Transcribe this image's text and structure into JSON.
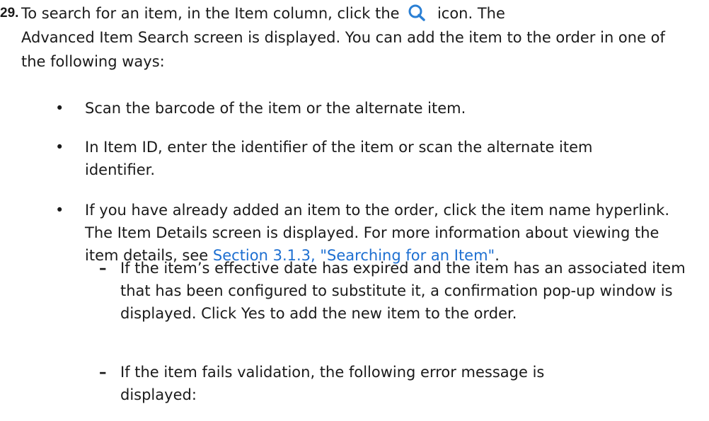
{
  "step": {
    "number": "29.",
    "line1_before_icon": "To search for an item, in the Item column, click the",
    "search_icon": "search-icon",
    "line1_after_icon": "icon. The",
    "continuation": "Advanced Item Search screen is displayed. You can add the item to the order in one of the following ways:"
  },
  "bullets": [
    {
      "text": "Scan the barcode of the item or the alternate item."
    },
    {
      "text": "In Item ID, enter the identifier of the item or scan the alternate item identifier."
    },
    {
      "text": "If you have already added an item to the order, click the item name hyperlink. The Item Details screen is displayed. For more information about viewing the item details, see",
      "link_text": "Section 3.1.3, \"Searching for an Item\"",
      "after_link": "."
    }
  ],
  "sub_items": [
    {
      "text": "If the item’s effective date has expired and the item has an associated item that has been configured to substitute it, a confirmation pop-up window is displayed. Click Yes to add the new item to the order."
    },
    {
      "text": "If the item fails validation, the following error message is displayed:"
    }
  ],
  "colors": {
    "link": "#1d6fd1",
    "icon": "#2a7fd4",
    "text": "#1a1a1a"
  }
}
